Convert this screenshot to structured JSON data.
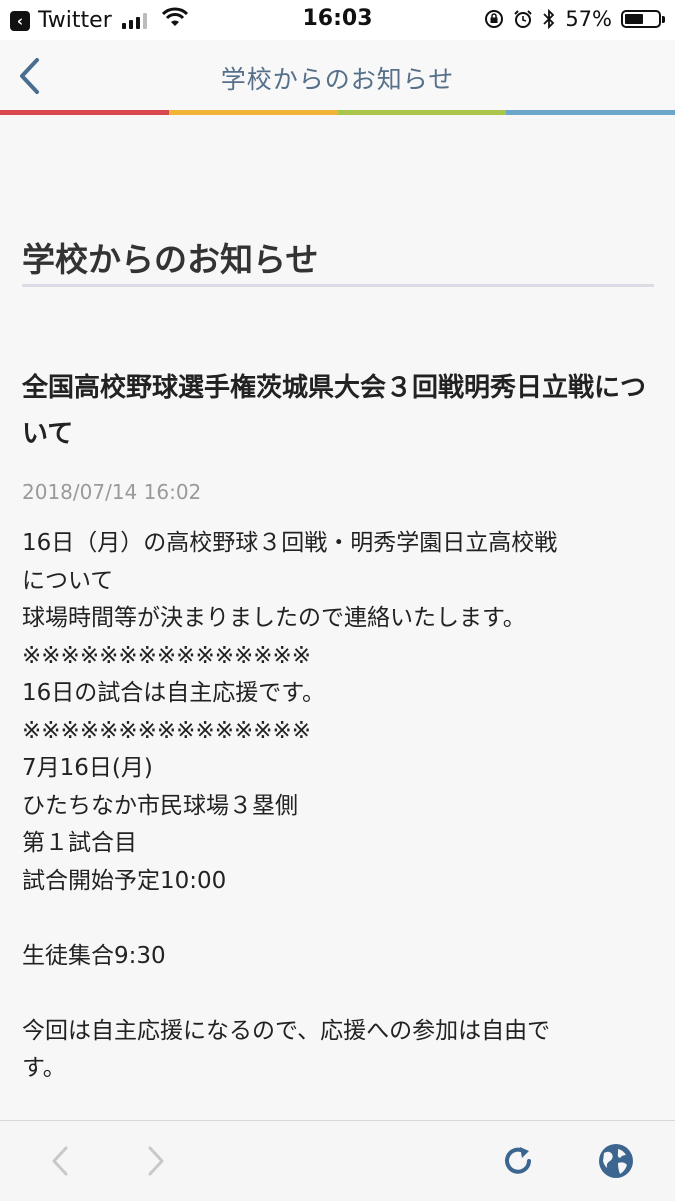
{
  "status_bar": {
    "back_app_label": "Twitter",
    "time": "16:03",
    "battery_percent": "57%",
    "battery_level": 0.57
  },
  "nav": {
    "title": "学校からのお知らせ",
    "rainbow_colors": [
      "#d9474f",
      "#f1b436",
      "#a9c64a",
      "#6aa7c9"
    ]
  },
  "page": {
    "heading": "学校からのお知らせ"
  },
  "article": {
    "title": "全国高校野球選手権茨城県大会３回戦明秀日立戦について",
    "timestamp": "2018/07/14 16:02",
    "lines": [
      "16日（月）の高校野球３回戦・明秀学園日立高校戦",
      "について",
      "球場時間等が決まりましたので連絡いたします。",
      "※※※※※※※※※※※※※※※",
      "16日の試合は自主応援です。",
      "※※※※※※※※※※※※※※※",
      "7月16日(月)",
      "ひたちなか市民球場３塁側",
      "第１試合目",
      "試合開始予定10:00",
      "",
      "生徒集合9:30",
      "",
      "今回は自主応援になるので、応援への参加は自由で",
      "す。"
    ]
  },
  "toolbar": {
    "icons": [
      "back-icon",
      "forward-icon",
      "reload-icon",
      "globe-icon"
    ]
  }
}
